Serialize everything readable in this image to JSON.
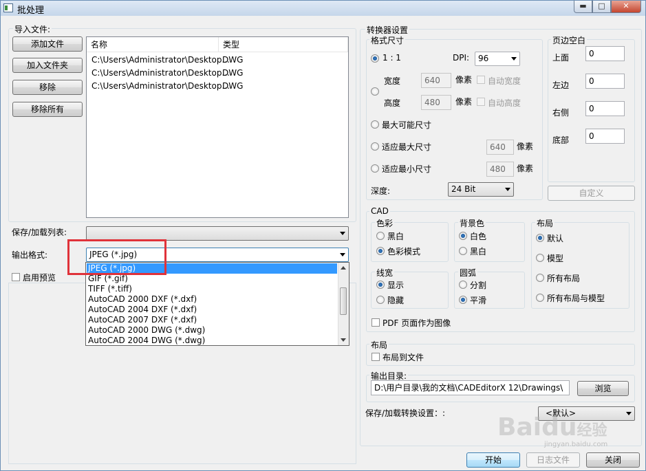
{
  "window": {
    "title": "批处理",
    "controls": {
      "minimize": "▬",
      "maximize": "□",
      "close": "✕"
    }
  },
  "import_files": {
    "group_title": "导入文件:",
    "buttons": {
      "add_file": "添加文件",
      "add_folder": "加入文件夹",
      "remove": "移除",
      "remove_all": "移除所有"
    },
    "columns": [
      "名称",
      "类型"
    ],
    "rows": [
      {
        "name": "C:\\Users\\Administrator\\Desktop...",
        "type": "DWG"
      },
      {
        "name": "C:\\Users\\Administrator\\Desktop...",
        "type": "DWG"
      },
      {
        "name": "C:\\Users\\Administrator\\Desktop...",
        "type": "DWG"
      }
    ]
  },
  "save_load_list": {
    "label": "保存/加载列表:",
    "value": ""
  },
  "output_format": {
    "label": "输出格式:",
    "value": "JPEG (*.jpg)",
    "options": [
      "JPEG (*.jpg)",
      "GIF (*.gif)",
      "TIFF (*.tiff)",
      "AutoCAD 2000 DXF (*.dxf)",
      "AutoCAD 2004 DXF (*.dxf)",
      "AutoCAD 2007 DXF (*.dxf)",
      "AutoCAD 2000 DWG (*.dwg)",
      "AutoCAD 2004 DWG (*.dwg)"
    ],
    "selected_index": 0
  },
  "enable_preview": {
    "label": "启用预览",
    "checked": false
  },
  "converter": {
    "group_title": "转换器设置",
    "format_size": {
      "group_title": "格式尺寸",
      "ratio_label": "1 : 1",
      "ratio_underline": "1",
      "dpi_label": "DPI:",
      "dpi_value": "96",
      "width_label": "宽度",
      "width_value": "640",
      "width_unit": "像素",
      "auto_width": "自动宽度",
      "height_label": "高度",
      "height_value": "480",
      "height_unit": "像素",
      "auto_height": "自动高度",
      "max_possible": "最大可能尺寸",
      "fit_max": "适应最大尺寸",
      "fit_max_value": "640",
      "fit_max_unit": "像素",
      "fit_min": "适应最小尺寸",
      "fit_min_value": "480",
      "fit_min_unit": "像素",
      "depth_label": "深度:",
      "depth_value": "24 Bit"
    },
    "margins": {
      "group_title": "页边空白",
      "top_label": "上面",
      "top_value": "0",
      "left_label": "左边",
      "left_value": "0",
      "right_label": "右侧",
      "right_value": "0",
      "bottom_label": "底部",
      "bottom_value": "0",
      "custom_button": "自定义"
    },
    "cad": {
      "group_title": "CAD",
      "color": {
        "title": "色彩",
        "options": [
          "黑白",
          "色彩模式"
        ],
        "selected": 1
      },
      "background": {
        "title": "背景色",
        "options": [
          "白色",
          "黑白"
        ],
        "selected": 0
      },
      "layout": {
        "title": "布局",
        "options": [
          "默认",
          "模型",
          "所有布局",
          "所有布局与模型"
        ],
        "selected": 0
      },
      "line_width": {
        "title": "线宽",
        "options": [
          "显示",
          "隐藏"
        ],
        "selected": 0
      },
      "arc": {
        "title": "圆弧",
        "options": [
          "分割",
          "平滑"
        ],
        "selected": 1
      },
      "pdf_page_as_image": "PDF 页面作为图像"
    },
    "layout_group": {
      "group_title": "布局",
      "layout_to_file": "布局到文件"
    },
    "output_dir": {
      "label": "输出目录:",
      "value": "D:\\用户目录\\我的文档\\CADEditorX 12\\Drawings\\",
      "browse": "浏览"
    },
    "save_load_settings": {
      "label": "保存/加载转换设置：:",
      "value": "<默认>"
    }
  },
  "footer": {
    "start": "开始",
    "log": "日志文件",
    "close": "关闭"
  },
  "watermark": {
    "brand_a": "Bai",
    "brand_b": "du",
    "brand_c": "经验",
    "url": "jingyan.baidu.com"
  }
}
